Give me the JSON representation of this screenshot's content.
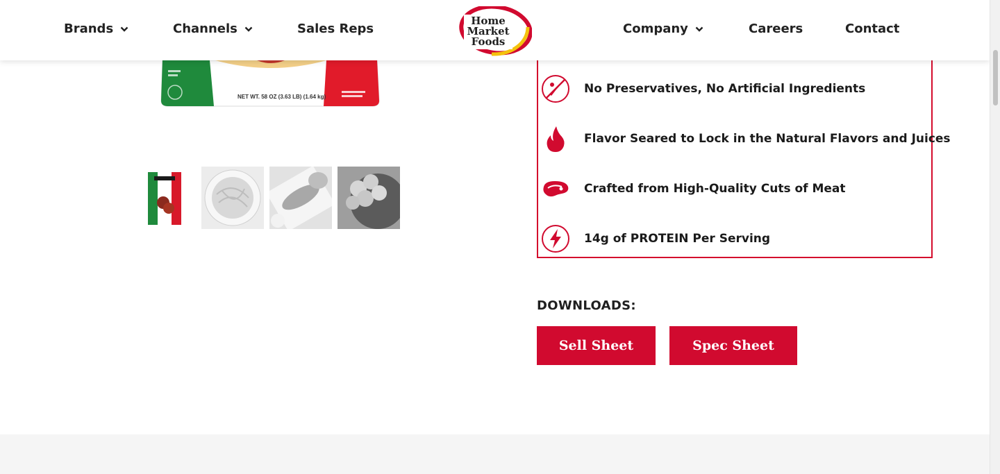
{
  "nav": {
    "left": [
      {
        "label": "Brands",
        "has_dropdown": true
      },
      {
        "label": "Channels",
        "has_dropdown": true
      },
      {
        "label": "Sales Reps",
        "has_dropdown": false
      }
    ],
    "right": [
      {
        "label": "Company",
        "has_dropdown": true
      },
      {
        "label": "Careers",
        "has_dropdown": false
      },
      {
        "label": "Contact",
        "has_dropdown": false
      }
    ]
  },
  "logo": {
    "line1": "Home",
    "line2": "Market",
    "line3": "Foods"
  },
  "product_bag": {
    "net_weight": "NET WT. 58 OZ (3.63 LB) (1.64 kg)"
  },
  "features": [
    {
      "icon": "no-preservatives-icon",
      "text": "No Preservatives, No Artificial Ingredients"
    },
    {
      "icon": "flame-icon",
      "text": "Flavor Seared to Lock in the Natural Flavors and Juices"
    },
    {
      "icon": "steak-icon",
      "text": "Crafted from High-Quality Cuts of Meat"
    },
    {
      "icon": "lightning-bolt-icon",
      "text": "14g of PROTEIN Per Serving"
    }
  ],
  "downloads": {
    "label": "DOWNLOADS:",
    "buttons": [
      {
        "label": "Sell Sheet"
      },
      {
        "label": "Spec Sheet"
      }
    ]
  },
  "colors": {
    "brand_red": "#d10a2f",
    "logo_yellow": "#f4c20d"
  }
}
